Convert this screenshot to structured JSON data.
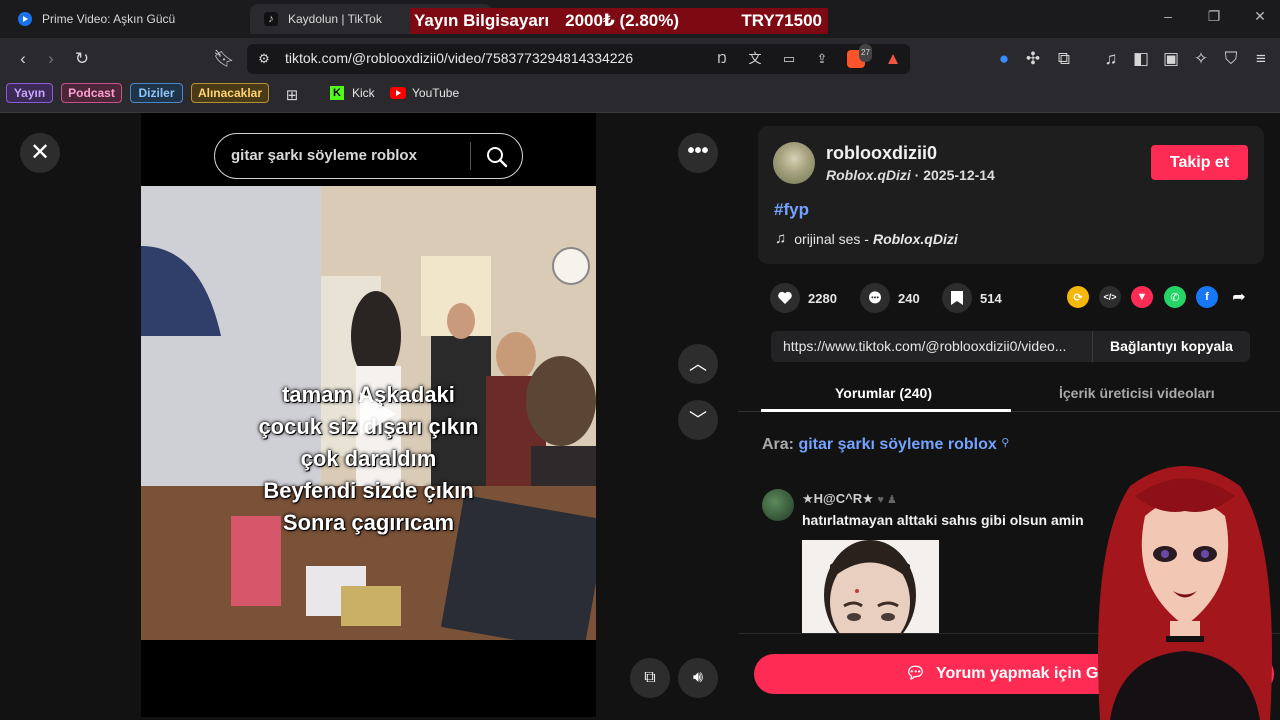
{
  "browser": {
    "tabs": [
      {
        "title": "Prime Video: Aşkın Gücü"
      },
      {
        "title": "Kaydolun | TikTok"
      }
    ],
    "url": "tiktok.com/@roblooxdizii0/video/7583773294814334226",
    "shield_count": "27",
    "bookmarks": {
      "chips": [
        "Yayın",
        "Podcast",
        "Diziler",
        "Alınacaklar"
      ],
      "links": [
        "Kick",
        "YouTube"
      ]
    }
  },
  "ticker": {
    "label": "Yayın Bilgisayarı",
    "price": "2000₺ (2.80%)",
    "goal": "TRY71500"
  },
  "player": {
    "search_query": "gitar şarkı söyleme roblox",
    "captions": [
      "tamam Aşkadaki",
      "çocuk siz dışarı çıkın",
      "çok daraldım",
      "Beyfendi sizde çıkın",
      "Sonra çagırıcam"
    ]
  },
  "post": {
    "username": "roblooxdizii0",
    "nickname": "Roblox.qDizi",
    "date": "2025-12-14",
    "follow_label": "Takip et",
    "hashtag": "#fyp",
    "music_prefix": "orijinal ses - ",
    "music_author": "Roblox.qDizi",
    "likes": "2280",
    "comments": "240",
    "saves": "514",
    "link": "https://www.tiktok.com/@roblooxdizii0/video...",
    "copy_link_label": "Bağlantıyı kopyala",
    "tab_comments": "Yorumlar (240)",
    "tab_creator_videos": "İçerik üreticisi videoları",
    "search_prefix": "Ara: ",
    "search_term": "gitar şarkı söyleme roblox",
    "comment": {
      "author": "★H@C^R★",
      "text": "hatırlatmayan alttaki sahıs gibi olsun amin"
    },
    "login_label": "Yorum yapmak için Giriş"
  },
  "colors": {
    "accent": "#fe2c55",
    "link": "#73a3ff",
    "ticker_bg": "#7d0a12",
    "background": "#121212"
  }
}
